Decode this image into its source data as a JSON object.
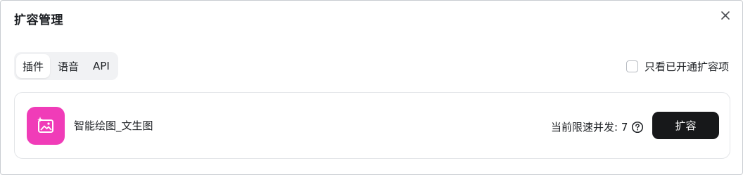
{
  "dialog": {
    "title": "扩容管理",
    "close_icon": "close-icon"
  },
  "tabs": [
    {
      "label": "插件",
      "active": true
    },
    {
      "label": "语音",
      "active": false
    },
    {
      "label": "API",
      "active": false
    }
  ],
  "filter": {
    "label": "只看已开通扩容项",
    "checked": false
  },
  "plugin": {
    "name": "智能绘图_文生图",
    "icon": "image-sparkle-icon",
    "icon_color": "#f03cb8",
    "rate_label": "当前限速并发: 7",
    "help_icon": "question-circle-icon",
    "button_label": "扩容",
    "button_color": "#17181a"
  }
}
